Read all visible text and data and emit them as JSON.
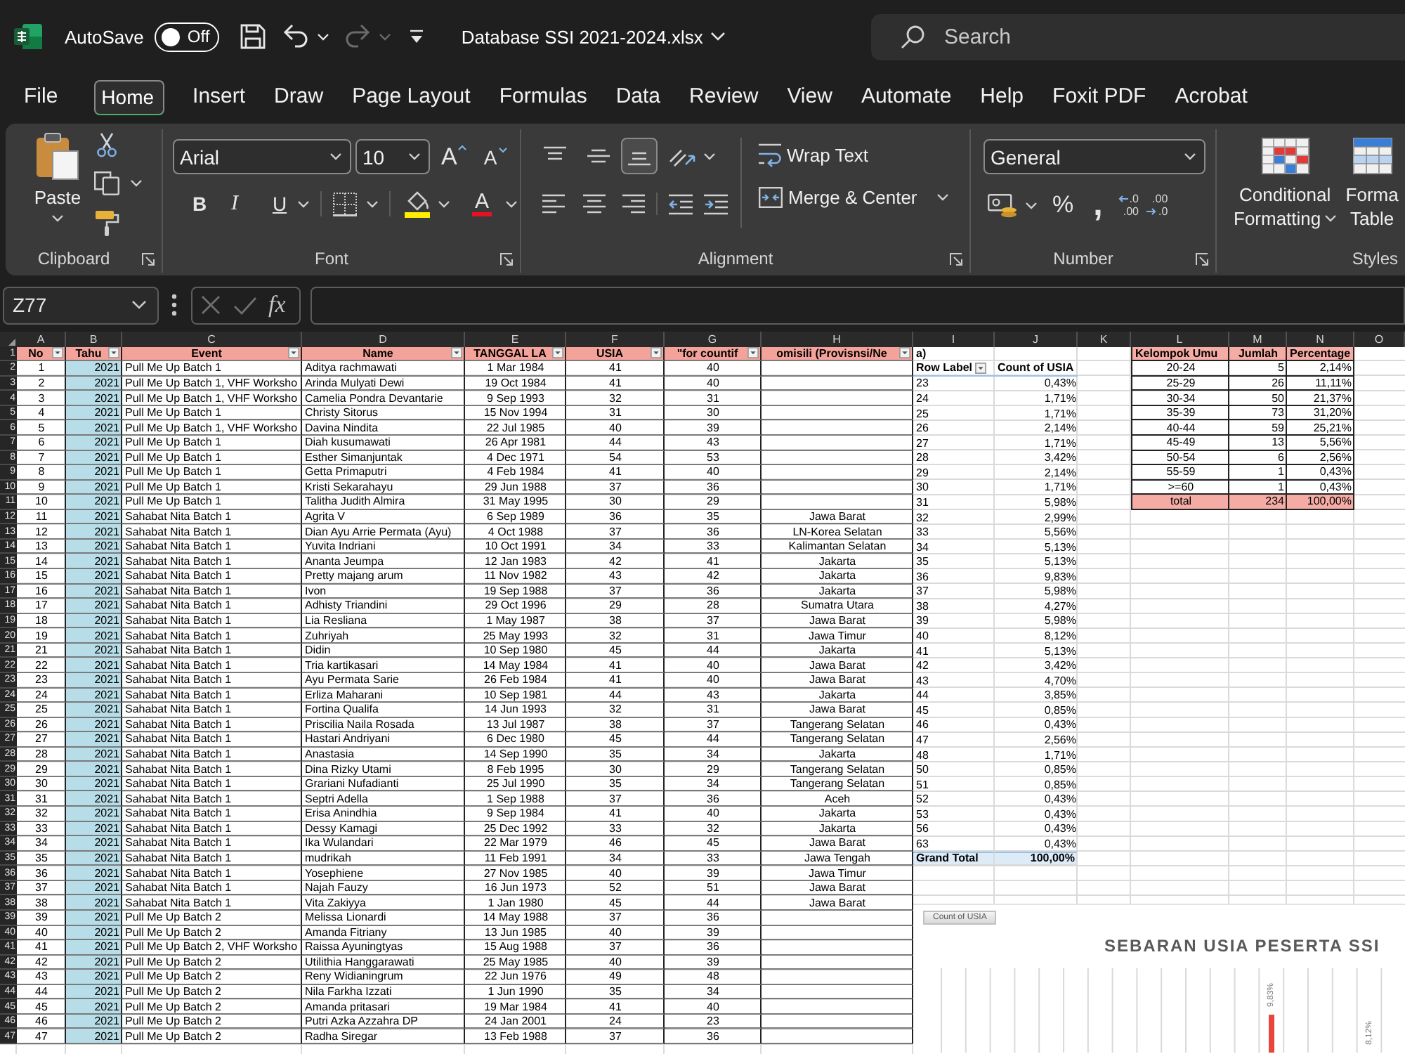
{
  "title_bar": {
    "autosave": {
      "label": "AutoSave",
      "on": false,
      "state_text": "Off"
    },
    "quick_access": [
      {
        "kind": "save",
        "disabled": false
      },
      {
        "kind": "undo",
        "disabled": false
      },
      {
        "kind": "redo",
        "disabled": true
      },
      {
        "kind": "customize",
        "disabled": false
      }
    ],
    "document_title": "Database SSI 2021-2024.xlsx",
    "search": {
      "placeholder": "Search"
    }
  },
  "menu_tabs": [
    {
      "label": "File",
      "selected": false
    },
    {
      "label": "Home",
      "selected": true
    },
    {
      "label": "Insert",
      "selected": false
    },
    {
      "label": "Draw",
      "selected": false
    },
    {
      "label": "Page Layout",
      "selected": false
    },
    {
      "label": "Formulas",
      "selected": false
    },
    {
      "label": "Data",
      "selected": false
    },
    {
      "label": "Review",
      "selected": false
    },
    {
      "label": "View",
      "selected": false
    },
    {
      "label": "Automate",
      "selected": false
    },
    {
      "label": "Help",
      "selected": false
    },
    {
      "label": "Foxit PDF",
      "selected": false
    },
    {
      "label": "Acrobat",
      "selected": false
    }
  ],
  "ribbon": {
    "clipboard": {
      "label": "Clipboard",
      "paste": "Paste"
    },
    "font": {
      "label": "Font",
      "font_name": "Arial",
      "font_size": "10",
      "grow": "A",
      "shrink": "A",
      "bold": "B",
      "italic": "I",
      "underline": "U",
      "font_color": "A"
    },
    "alignment": {
      "label": "Alignment",
      "vertical_align": [
        {
          "kind": "top",
          "selected": false
        },
        {
          "kind": "middle",
          "selected": false
        },
        {
          "kind": "bottom",
          "selected": true
        }
      ],
      "wrap_text": "Wrap Text",
      "merge": "Merge & Center"
    },
    "number": {
      "label": "Number",
      "format": "General",
      "percent": "%",
      "comma": ",",
      "decimals": [
        {
          "kind": "increase",
          "top": ".0",
          "bottom": ".00"
        },
        {
          "kind": "decrease",
          "top": ".00",
          "bottom": ".0"
        }
      ]
    },
    "styles": {
      "label": "Styles",
      "conditional_formatting": [
        "Conditional",
        "Formatting"
      ],
      "format_as_table": [
        "Forma",
        "Table"
      ]
    }
  },
  "formula_bar": {
    "name_box": "Z77",
    "function_label": "fx"
  },
  "sheet": {
    "column_letters": [
      "A",
      "B",
      "C",
      "D",
      "E",
      "F",
      "G",
      "H",
      "I",
      "J",
      "K",
      "L",
      "M",
      "N",
      "O"
    ],
    "row_numbers": [
      "1",
      "2",
      "3",
      "4",
      "5",
      "6",
      "7",
      "8",
      "9",
      "10",
      "11",
      "12",
      "13",
      "14",
      "15",
      "16",
      "17",
      "18",
      "19",
      "20",
      "21",
      "22",
      "23",
      "24",
      "25",
      "26",
      "27",
      "28",
      "29",
      "30",
      "31",
      "32",
      "33",
      "34",
      "35",
      "36",
      "37",
      "38",
      "39",
      "40",
      "41",
      "42",
      "43",
      "44",
      "45",
      "46",
      "47"
    ]
  },
  "participants_table": {
    "headers": [
      "No",
      "Tahu",
      "Event",
      "Name",
      "TANGGAL LA",
      "USIA",
      "\"for countif",
      "omisili (Provisnsi/Ne"
    ],
    "header_overflow": "a)",
    "rows": [
      [
        "1",
        "2021",
        "Pull Me Up Batch 1",
        "Aditya rachmawati",
        "1 Mar 1984",
        "41",
        "40"
      ],
      [
        "2",
        "2021",
        "Pull Me Up Batch 1, VHF Worksho",
        "Arinda Mulyati Dewi",
        "19 Oct 1984",
        "41",
        "40"
      ],
      [
        "3",
        "2021",
        "Pull Me Up Batch 1, VHF Worksho",
        "Camelia Pondra Devantarie",
        "9 Sep 1993",
        "32",
        "31"
      ],
      [
        "4",
        "2021",
        "Pull Me Up Batch 1",
        "Christy Sitorus",
        "15 Nov 1994",
        "31",
        "30"
      ],
      [
        "5",
        "2021",
        "Pull Me Up Batch 1, VHF Worksho",
        "Davina Nindita",
        "22 Jul 1985",
        "40",
        "39"
      ],
      [
        "6",
        "2021",
        "Pull Me Up Batch 1",
        "Diah kusumawati",
        "26 Apr 1981",
        "44",
        "43"
      ],
      [
        "7",
        "2021",
        "Pull Me Up Batch 1",
        "Esther Simanjuntak",
        "4 Dec 1971",
        "54",
        "53"
      ],
      [
        "8",
        "2021",
        "Pull Me Up Batch 1",
        "Getta Primaputri",
        "4 Feb 1984",
        "41",
        "40"
      ],
      [
        "9",
        "2021",
        "Pull Me Up Batch 1",
        "Kristi Sekarahayu",
        "29 Jun 1988",
        "37",
        "36"
      ],
      [
        "10",
        "2021",
        "Pull Me Up Batch 1",
        "Talitha Judith Almira",
        "31 May 1995",
        "30",
        "29"
      ],
      [
        "11",
        "2021",
        "Sahabat Nita Batch 1",
        "Agrita V",
        "6 Sep 1989",
        "36",
        "35",
        "Jawa Barat"
      ],
      [
        "12",
        "2021",
        "Sahabat Nita Batch 1",
        "Dian Ayu Arrie Permata (Ayu)",
        "4 Oct 1988",
        "37",
        "36",
        "LN-Korea Selatan"
      ],
      [
        "13",
        "2021",
        "Sahabat Nita Batch 1",
        "Yuvita Indriani",
        "10 Oct 1991",
        "34",
        "33",
        "Kalimantan Selatan"
      ],
      [
        "14",
        "2021",
        "Sahabat Nita Batch 1",
        "Ananta Jeumpa",
        "12 Jan 1983",
        "42",
        "41",
        "Jakarta"
      ],
      [
        "15",
        "2021",
        "Sahabat Nita Batch 1",
        "Pretty majang arum",
        "11 Nov 1982",
        "43",
        "42",
        "Jakarta"
      ],
      [
        "16",
        "2021",
        "Sahabat Nita Batch 1",
        "Ivon",
        "19 Sep 1988",
        "37",
        "36",
        "Jakarta"
      ],
      [
        "17",
        "2021",
        "Sahabat Nita Batch 1",
        "Adhisty Triandini",
        "29 Oct 1996",
        "29",
        "28",
        "Sumatra Utara"
      ],
      [
        "18",
        "2021",
        "Sahabat Nita Batch 1",
        "Lia Resliana",
        "1 May 1987",
        "38",
        "37",
        "Jawa Barat"
      ],
      [
        "19",
        "2021",
        "Sahabat Nita Batch 1",
        "Zuhriyah",
        "25 May 1993",
        "32",
        "31",
        "Jawa Timur"
      ],
      [
        "21",
        "2021",
        "Sahabat Nita Batch 1",
        "Didin",
        "10 Sep 1980",
        "45",
        "44",
        "Jakarta"
      ],
      [
        "22",
        "2021",
        "Sahabat Nita Batch 1",
        "Tria kartikasari",
        "14 May 1984",
        "41",
        "40",
        "Jawa Barat"
      ],
      [
        "23",
        "2021",
        "Sahabat Nita Batch 1",
        "Ayu Permata Sarie",
        "26 Feb 1984",
        "41",
        "40",
        "Jawa Barat"
      ],
      [
        "24",
        "2021",
        "Sahabat Nita Batch 1",
        "Erliza Maharani",
        "10 Sep 1981",
        "44",
        "43",
        "Jakarta"
      ],
      [
        "25",
        "2021",
        "Sahabat Nita Batch 1",
        "Fortina Qualifa",
        "14 Jun 1993",
        "32",
        "31",
        "Jawa Barat"
      ],
      [
        "26",
        "2021",
        "Sahabat Nita Batch 1",
        "Priscilia Naila Rosada",
        "13 Jul 1987",
        "38",
        "37",
        "Tangerang Selatan"
      ],
      [
        "27",
        "2021",
        "Sahabat Nita Batch 1",
        "Hastari Andriyani",
        "6 Dec 1980",
        "45",
        "44",
        "Tangerang Selatan"
      ],
      [
        "28",
        "2021",
        "Sahabat Nita Batch 1",
        "Anastasia",
        "14 Sep 1990",
        "35",
        "34",
        "Jakarta"
      ],
      [
        "29",
        "2021",
        "Sahabat Nita Batch 1",
        "Dina Rizky Utami",
        "8 Feb 1995",
        "30",
        "29",
        "Tangerang Selatan"
      ],
      [
        "30",
        "2021",
        "Sahabat Nita Batch 1",
        "Grariani Nufadianti",
        "25 Jul 1990",
        "35",
        "34",
        "Tangerang Selatan"
      ],
      [
        "31",
        "2021",
        "Sahabat Nita Batch 1",
        "Septri Adella",
        "1 Sep 1988",
        "37",
        "36",
        "Aceh"
      ],
      [
        "32",
        "2021",
        "Sahabat Nita Batch 1",
        "Erisa Anindhia",
        "9 Sep 1984",
        "41",
        "40",
        "Jakarta"
      ],
      [
        "33",
        "2021",
        "Sahabat Nita Batch 1",
        "Dessy Kamagi",
        "25 Dec 1992",
        "33",
        "32",
        "Jakarta"
      ],
      [
        "34",
        "2021",
        "Sahabat Nita Batch 1",
        "Ika Wulandari",
        "22 Mar 1979",
        "46",
        "45",
        "Jawa Barat"
      ],
      [
        "35",
        "2021",
        "Sahabat Nita Batch 1",
        "mudrikah",
        "11 Feb 1991",
        "34",
        "33",
        "Jawa Tengah"
      ],
      [
        "36",
        "2021",
        "Sahabat Nita Batch 1",
        "Yosephiene",
        "27 Nov 1985",
        "40",
        "39",
        "Jawa Timur"
      ],
      [
        "37",
        "2021",
        "Sahabat Nita Batch 1",
        "Najah Fauzy",
        "16 Jun 1973",
        "52",
        "51",
        "Jawa Barat"
      ],
      [
        "38",
        "2021",
        "Sahabat Nita Batch 1",
        "Vita Zakiyya",
        "1 Jan 1980",
        "45",
        "44",
        "Jawa Barat"
      ],
      [
        "39",
        "2021",
        "Pull Me Up Batch 2",
        "Melissa Lionardi",
        "14 May 1988",
        "37",
        "36"
      ],
      [
        "40",
        "2021",
        "Pull Me Up Batch 2",
        "Amanda Fitriany",
        "13 Jun 1985",
        "40",
        "39"
      ],
      [
        "41",
        "2021",
        "Pull Me Up Batch 2, VHF Worksho",
        "Raissa Ayuningtyas",
        "15 Aug 1988",
        "37",
        "36"
      ],
      [
        "42",
        "2021",
        "Pull Me Up Batch 2",
        "Utilithia Hanggarawati",
        "25 May 1985",
        "40",
        "39"
      ],
      [
        "43",
        "2021",
        "Pull Me Up Batch 2",
        "Reny Widianingrum",
        "22 Jun 1976",
        "49",
        "48"
      ],
      [
        "44",
        "2021",
        "Pull Me Up Batch 2",
        "Nila Farkha Izzati",
        "1 Jun 1990",
        "35",
        "34"
      ],
      [
        "45",
        "2021",
        "Pull Me Up Batch 2",
        "Amanda pritasari",
        "19 Mar 1984",
        "41",
        "40"
      ],
      [
        "46",
        "2021",
        "Pull Me Up Batch 2",
        "Putri Azka Azzahra DP",
        "24 Jan 2001",
        "24",
        "23"
      ],
      [
        "47",
        "2021",
        "Pull Me Up Batch 2",
        "Radha Siregar",
        "13 Feb 1988",
        "37",
        "36"
      ]
    ]
  },
  "pivot_table": {
    "headers": [
      "Row Label",
      "Count of USIA"
    ],
    "rows": [
      [
        "23",
        "0,43%"
      ],
      [
        "24",
        "1,71%"
      ],
      [
        "25",
        "1,71%"
      ],
      [
        "26",
        "2,14%"
      ],
      [
        "27",
        "1,71%"
      ],
      [
        "28",
        "3,42%"
      ],
      [
        "29",
        "2,14%"
      ],
      [
        "30",
        "1,71%"
      ],
      [
        "31",
        "5,98%"
      ],
      [
        "32",
        "2,99%"
      ],
      [
        "33",
        "5,56%"
      ],
      [
        "34",
        "5,13%"
      ],
      [
        "35",
        "5,13%"
      ],
      [
        "36",
        "9,83%"
      ],
      [
        "37",
        "5,98%"
      ],
      [
        "38",
        "4,27%"
      ],
      [
        "39",
        "5,98%"
      ],
      [
        "40",
        "8,12%"
      ],
      [
        "41",
        "5,13%"
      ],
      [
        "42",
        "3,42%"
      ],
      [
        "43",
        "4,70%"
      ],
      [
        "44",
        "3,85%"
      ],
      [
        "45",
        "0,85%"
      ],
      [
        "46",
        "0,43%"
      ],
      [
        "47",
        "2,56%"
      ],
      [
        "48",
        "1,71%"
      ],
      [
        "50",
        "0,85%"
      ],
      [
        "51",
        "0,85%"
      ],
      [
        "52",
        "0,43%"
      ],
      [
        "53",
        "0,43%"
      ],
      [
        "56",
        "0,43%"
      ],
      [
        "63",
        "0,43%"
      ]
    ],
    "total": [
      "Grand Total",
      "100,00%"
    ]
  },
  "age_group_table": {
    "headers": [
      "Kelompok Umu",
      "Jumlah",
      "Percentage"
    ],
    "rows": [
      [
        "20-24",
        "5",
        "2,14%"
      ],
      [
        "25-29",
        "26",
        "11,11%"
      ],
      [
        "30-34",
        "50",
        "21,37%"
      ],
      [
        "35-39",
        "73",
        "31,20%"
      ],
      [
        "40-44",
        "59",
        "25,21%"
      ],
      [
        "45-49",
        "13",
        "5,56%"
      ],
      [
        "50-54",
        "6",
        "2,56%"
      ],
      [
        "55-59",
        "1",
        "0,43%"
      ],
      [
        ">=60",
        "1",
        "0,43%"
      ]
    ],
    "total": [
      "total",
      "234",
      "100,00%"
    ]
  },
  "chart": {
    "field_button": "Count of USIA",
    "title": "SEBARAN USIA PESERTA SSI",
    "data_labels": [
      "9,83%",
      "8,12%"
    ]
  }
}
